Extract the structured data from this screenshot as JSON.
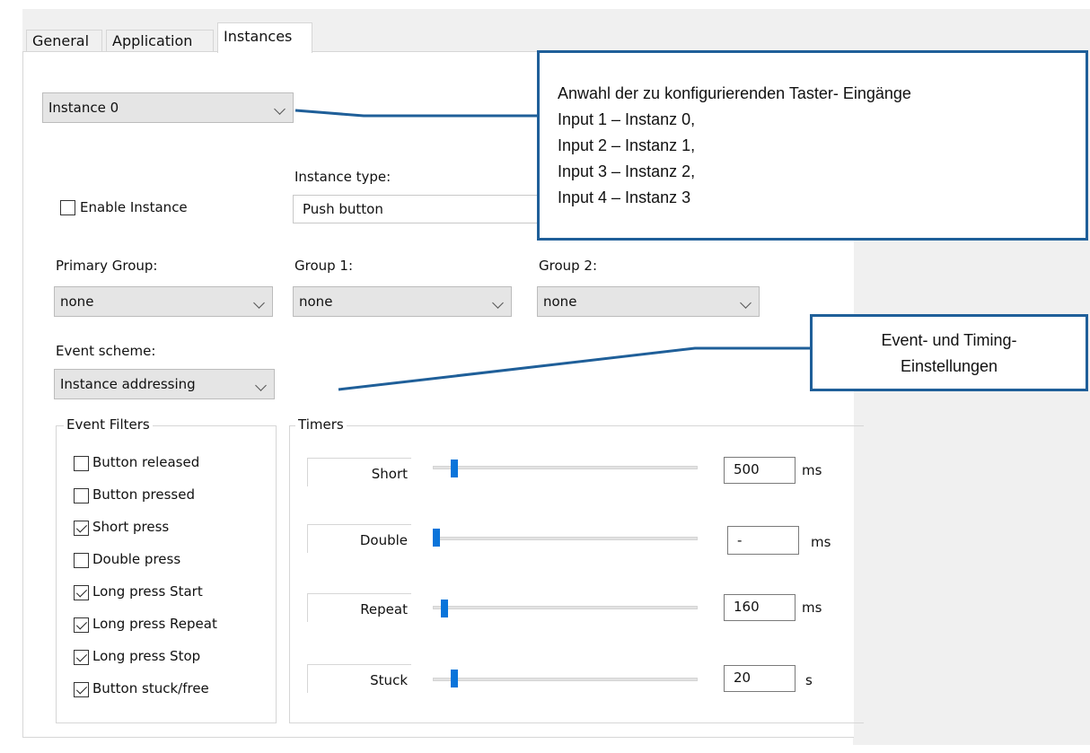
{
  "tabs": [
    {
      "label": "General",
      "active": false
    },
    {
      "label": "Application",
      "active": false
    },
    {
      "label": "Instances",
      "active": true
    }
  ],
  "instance_select": {
    "value": "Instance 0"
  },
  "enable_instance": {
    "label": "Enable Instance",
    "checked": false
  },
  "instance_type": {
    "label": "Instance type:",
    "value": "Push button"
  },
  "groups": {
    "primary": {
      "label": "Primary Group:",
      "value": "none"
    },
    "group1": {
      "label": "Group 1:",
      "value": "none"
    },
    "group2": {
      "label": "Group 2:",
      "value": "none"
    }
  },
  "event_scheme": {
    "label": "Event scheme:",
    "value": "Instance addressing"
  },
  "event_filters": {
    "title": "Event Filters",
    "items": [
      {
        "label": "Button released",
        "checked": false
      },
      {
        "label": "Button pressed",
        "checked": false
      },
      {
        "label": "Short press",
        "checked": true
      },
      {
        "label": "Double press",
        "checked": false
      },
      {
        "label": "Long press Start",
        "checked": true
      },
      {
        "label": "Long press Repeat",
        "checked": true
      },
      {
        "label": "Long press Stop",
        "checked": true
      },
      {
        "label": "Button stuck/free",
        "checked": true
      }
    ]
  },
  "timers": {
    "title": "Timers",
    "items": [
      {
        "label": "Short",
        "value": "500",
        "unit": "ms",
        "slider_fraction": 0.07
      },
      {
        "label": "Double",
        "value": "-",
        "unit": "ms",
        "slider_fraction": 0.0
      },
      {
        "label": "Repeat",
        "value": "160",
        "unit": "ms",
        "slider_fraction": 0.03
      },
      {
        "label": "Stuck",
        "value": "20",
        "unit": "s",
        "slider_fraction": 0.07
      }
    ]
  },
  "callouts": {
    "inputs": {
      "lines": [
        "Anwahl der zu konfigurierenden  Taster- Eingänge",
        "Input 1 – Instanz 0,",
        "Input 2 – Instanz 1,",
        "Input 3 – Instanz 2,",
        "Input 4 – Instanz 3"
      ]
    },
    "timing": {
      "lines": [
        "Event- und Timing-",
        "Einstellungen"
      ]
    }
  },
  "colors": {
    "accent": "#0a74da",
    "callout_border": "#1f5f99"
  }
}
